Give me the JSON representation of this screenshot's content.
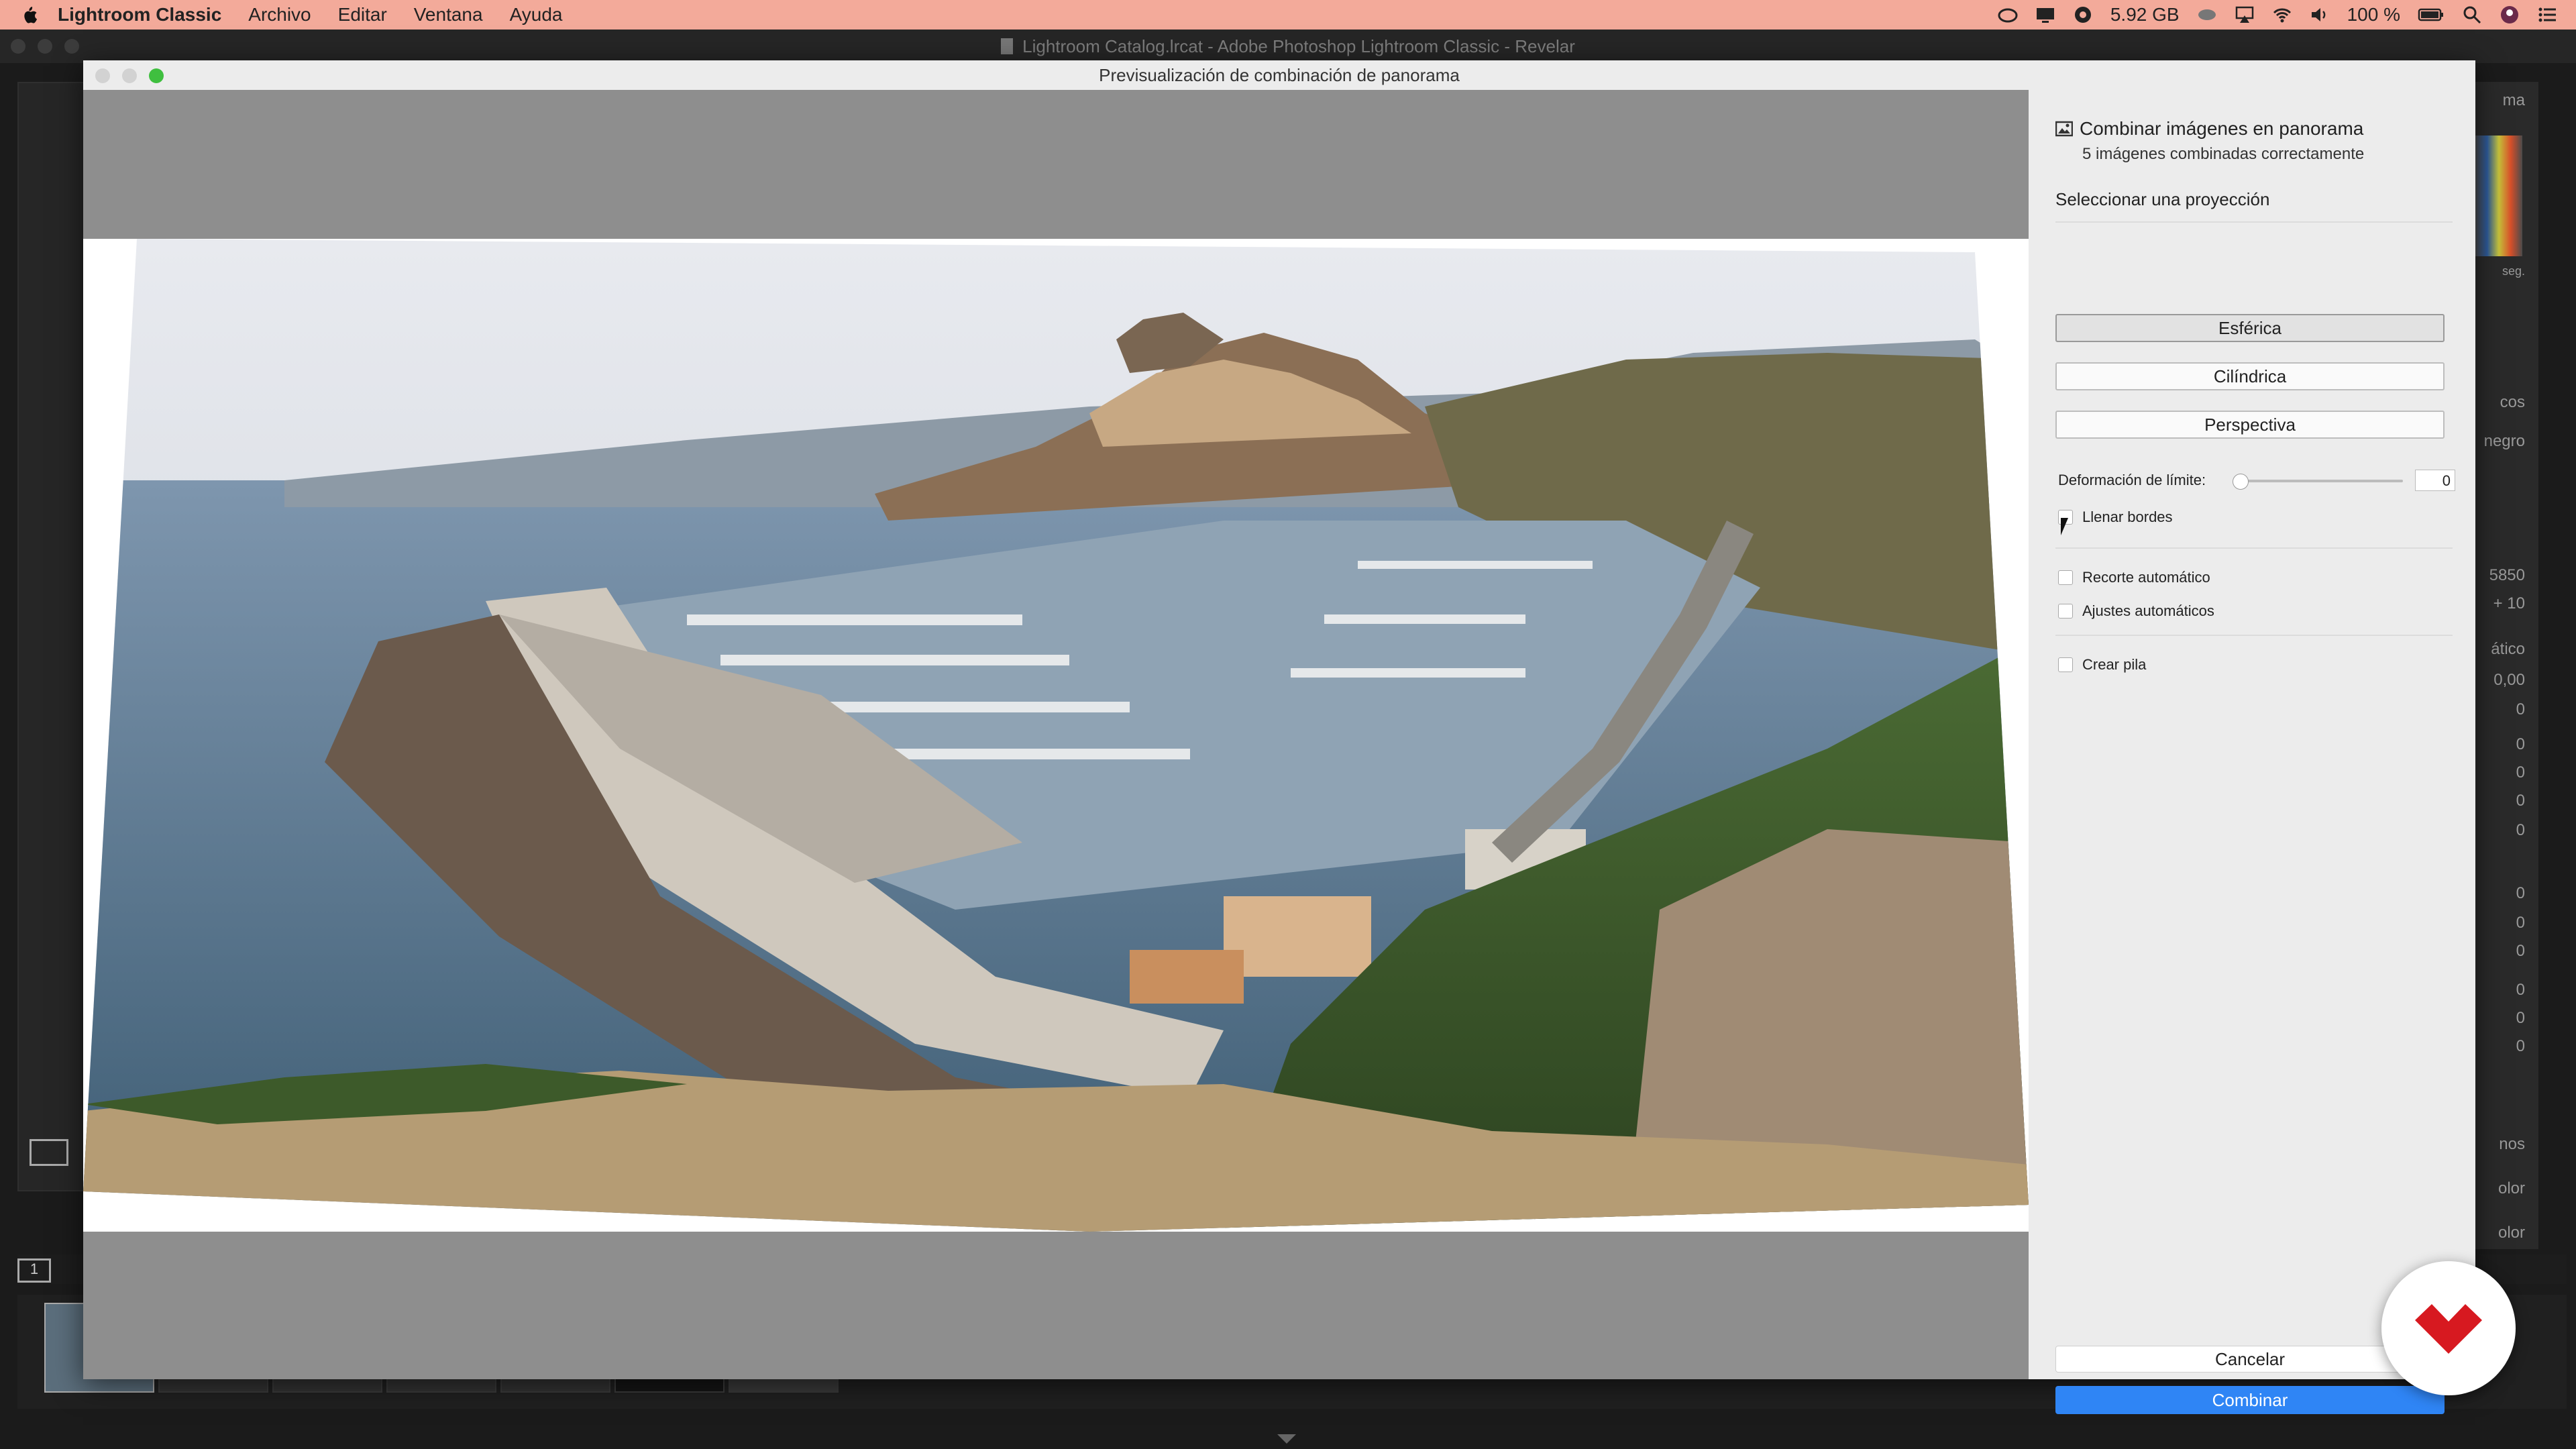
{
  "menubar": {
    "app_name": "Lightroom Classic",
    "items": [
      "Archivo",
      "Editar",
      "Ventana",
      "Ayuda"
    ],
    "memory": "5.92 GB",
    "battery": "100 %"
  },
  "window": {
    "title": "Lightroom Catalog.lrcat - Adobe Photoshop Lightroom Classic - Revelar"
  },
  "dialog": {
    "title": "Previsualización de combinación de panorama",
    "header": "Combinar imágenes en panorama",
    "status": "5 imágenes combinadas correctamente",
    "projection_label": "Seleccionar una proyección",
    "projections": [
      "Esférica",
      "Cilíndrica",
      "Perspectiva"
    ],
    "selected_projection": "Esférica",
    "boundary_warp_label": "Deformación de límite:",
    "boundary_warp_value": "0",
    "fill_edges_label": "Llenar bordes",
    "auto_crop_label": "Recorte automático",
    "auto_settings_label": "Ajustes automáticos",
    "create_stack_label": "Crear pila",
    "cancel_label": "Cancelar",
    "merge_label": "Combinar"
  },
  "right_panel": {
    "labels": [
      "ma",
      "seg.",
      "cos",
      "negro",
      "5850",
      "+ 10",
      "ático",
      "0,00",
      "0",
      "0",
      "0",
      "0",
      "0",
      "0",
      "0",
      "0",
      "0",
      "0",
      "0",
      "nos",
      "olor",
      "olor"
    ]
  },
  "filmstrip": {
    "page_number": "1"
  },
  "colors": {
    "menubar": "#f3aa9a",
    "primary_button": "#2f85f5",
    "brand_red": "#d71920"
  }
}
